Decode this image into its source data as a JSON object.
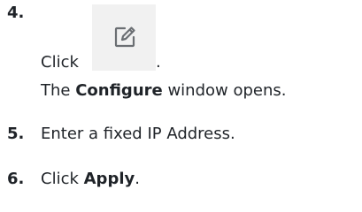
{
  "steps": [
    {
      "number": "4.",
      "click_text": "Click",
      "icon": "edit-icon",
      "after_icon": ".",
      "desc_before": "The ",
      "desc_bold": "Configure",
      "desc_after": " window opens."
    },
    {
      "number": "5.",
      "text": "Enter a fixed IP Address."
    },
    {
      "number": "6.",
      "text_before": "Click ",
      "text_bold": "Apply",
      "text_after": "."
    }
  ],
  "colors": {
    "text": "#1f2328",
    "icon_bg": "#f1f1f1",
    "icon_stroke": "#6b6f73"
  }
}
